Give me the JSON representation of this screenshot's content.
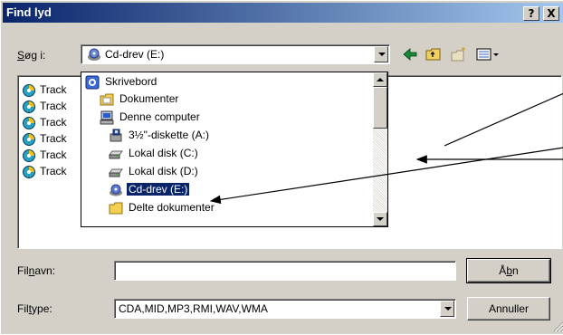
{
  "window": {
    "title": "Find lyd"
  },
  "titlebar": {
    "help_label": "?",
    "close_label": "X"
  },
  "lookin": {
    "label": "Søg i:",
    "label_access_key": "S",
    "label_rest": "øg i:",
    "value": "Cd-drev (E:)"
  },
  "files": [
    "Track",
    "Track",
    "Track",
    "Track",
    "Track",
    "Track"
  ],
  "dropdown": {
    "items": [
      {
        "label": "Skrivebord",
        "icon": "desktop-icon"
      },
      {
        "label": "Dokumenter",
        "icon": "folder-icon"
      },
      {
        "label": "Denne computer",
        "icon": "computer-icon"
      },
      {
        "label": "3½\"-diskette (A:)",
        "icon": "floppy-icon"
      },
      {
        "label": "Lokal disk (C:)",
        "icon": "harddisk-icon"
      },
      {
        "label": "Lokal disk (D:)",
        "icon": "harddisk-icon"
      },
      {
        "label": "Cd-drev (E:)",
        "icon": "cd-drive-icon"
      },
      {
        "label": "Delte dokumenter",
        "icon": "folder-icon"
      }
    ]
  },
  "filename": {
    "label_pre": "Fil",
    "label_key": "n",
    "label_post": "avn:",
    "value": ""
  },
  "filetype": {
    "label_pre": "Fil",
    "label_key": "t",
    "label_post": "ype:",
    "value": "CDA,MID,MP3,RMI,WAV,WMA"
  },
  "buttons": {
    "open_pre": "Å",
    "open_key": "b",
    "open_post": "n",
    "cancel": "Annuller"
  },
  "colors": {
    "titlebar": "#0a246a",
    "face": "#d4d0c8",
    "selection": "#0a246a"
  }
}
